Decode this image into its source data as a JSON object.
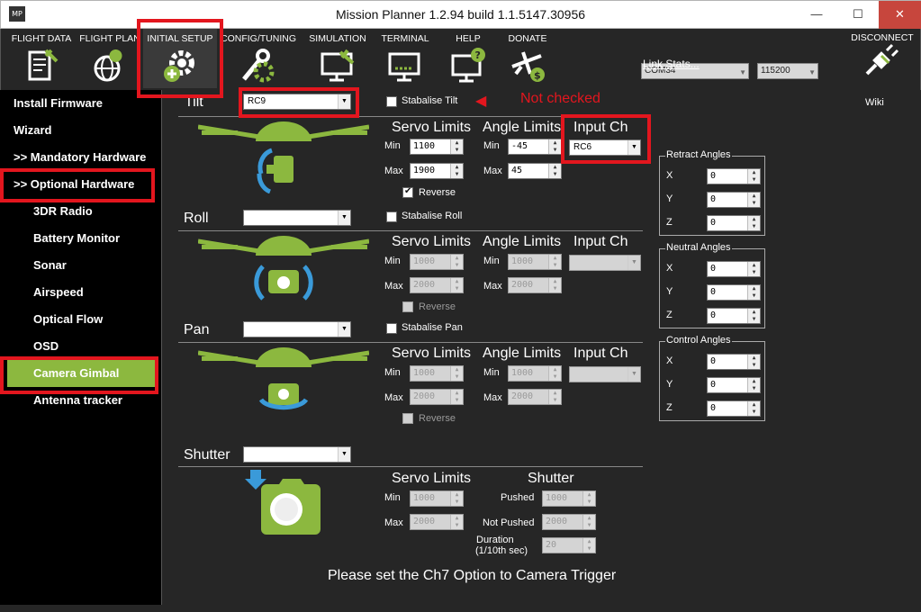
{
  "window": {
    "title": "Mission Planner 1.2.94 build 1.1.5147.30956",
    "app_icon": "MP",
    "min_glyph": "—",
    "max_glyph": "☐",
    "close_glyph": "✕"
  },
  "toolbar": {
    "items": [
      {
        "label": "FLIGHT DATA",
        "icon": "flight-data-icon"
      },
      {
        "label": "FLIGHT PLAN",
        "icon": "flight-plan-icon"
      },
      {
        "label": "INITIAL SETUP",
        "icon": "initial-setup-icon",
        "active": true
      },
      {
        "label": "CONFIG/TUNING",
        "icon": "config-tuning-icon"
      },
      {
        "label": "SIMULATION",
        "icon": "simulation-icon"
      },
      {
        "label": "TERMINAL",
        "icon": "terminal-icon"
      },
      {
        "label": "HELP",
        "icon": "help-icon"
      },
      {
        "label": "DONATE",
        "icon": "donate-icon"
      }
    ],
    "com_port": "COM34",
    "baud": "115200",
    "link_stats": "Link Stats...",
    "disconnect": "DISCONNECT"
  },
  "sidebar": {
    "items": [
      {
        "label": "Install Firmware"
      },
      {
        "label": "Wizard"
      },
      {
        "label": ">> Mandatory Hardware"
      },
      {
        "label": ">> Optional Hardware"
      },
      {
        "label": "3DR Radio"
      },
      {
        "label": "Battery Monitor"
      },
      {
        "label": "Sonar"
      },
      {
        "label": "Airspeed"
      },
      {
        "label": "Optical Flow"
      },
      {
        "label": "OSD"
      },
      {
        "label": "Camera Gimbal",
        "selected": true
      },
      {
        "label": "Antenna tracker"
      }
    ]
  },
  "annotation": {
    "note": "Not checked",
    "arrow_glyph": "◀"
  },
  "wiki": "Wiki",
  "tilt": {
    "label": "Tilt",
    "channel": "RC9",
    "stabilise": "Stabalise Tilt",
    "servo_hdr": "Servo Limits",
    "angle_hdr": "Angle Limits",
    "input_hdr": "Input Ch",
    "input_ch": "RC6",
    "min_lbl": "Min",
    "max_lbl": "Max",
    "servo_min": "1100",
    "servo_max": "1900",
    "angle_min": "-45",
    "angle_max": "45",
    "reverse": "Reverse"
  },
  "roll": {
    "label": "Roll",
    "channel": "",
    "stabilise": "Stabalise Roll",
    "servo_hdr": "Servo Limits",
    "angle_hdr": "Angle Limits",
    "input_hdr": "Input Ch",
    "min_lbl": "Min",
    "max_lbl": "Max",
    "servo_min": "1000",
    "servo_max": "2000",
    "angle_min": "1000",
    "angle_max": "2000",
    "reverse": "Reverse"
  },
  "pan": {
    "label": "Pan",
    "channel": "",
    "stabilise": "Stabalise Pan",
    "servo_hdr": "Servo Limits",
    "angle_hdr": "Angle Limits",
    "input_hdr": "Input Ch",
    "min_lbl": "Min",
    "max_lbl": "Max",
    "servo_min": "1000",
    "servo_max": "2000",
    "angle_min": "1000",
    "angle_max": "2000",
    "reverse": "Reverse"
  },
  "shutter": {
    "label": "Shutter",
    "channel": "",
    "servo_hdr": "Servo Limits",
    "shutter_hdr": "Shutter",
    "min_lbl": "Min",
    "max_lbl": "Max",
    "servo_min": "1000",
    "servo_max": "2000",
    "pushed_lbl": "Pushed",
    "pushed": "1000",
    "not_pushed_lbl": "Not Pushed",
    "not_pushed": "2000",
    "duration_lbl1": "Duration",
    "duration_lbl2": "(1/10th sec)",
    "duration": "20",
    "trigger_msg": "Please set the Ch7 Option to Camera Trigger"
  },
  "retract": {
    "title": "Retract Angles",
    "x": "0",
    "y": "0",
    "z": "0"
  },
  "neutral": {
    "title": "Neutral Angles",
    "x": "0",
    "y": "0",
    "z": "0"
  },
  "control": {
    "title": "Control Angles",
    "x": "0",
    "y": "0",
    "z": "0"
  },
  "axis": {
    "x": "X",
    "y": "Y",
    "z": "Z"
  },
  "glyphs": {
    "up": "▲",
    "down": "▼"
  },
  "colors": {
    "accent_green": "#8cb83f",
    "highlight_red": "#e3161e",
    "gimbal_blue": "#3a9ad9"
  }
}
